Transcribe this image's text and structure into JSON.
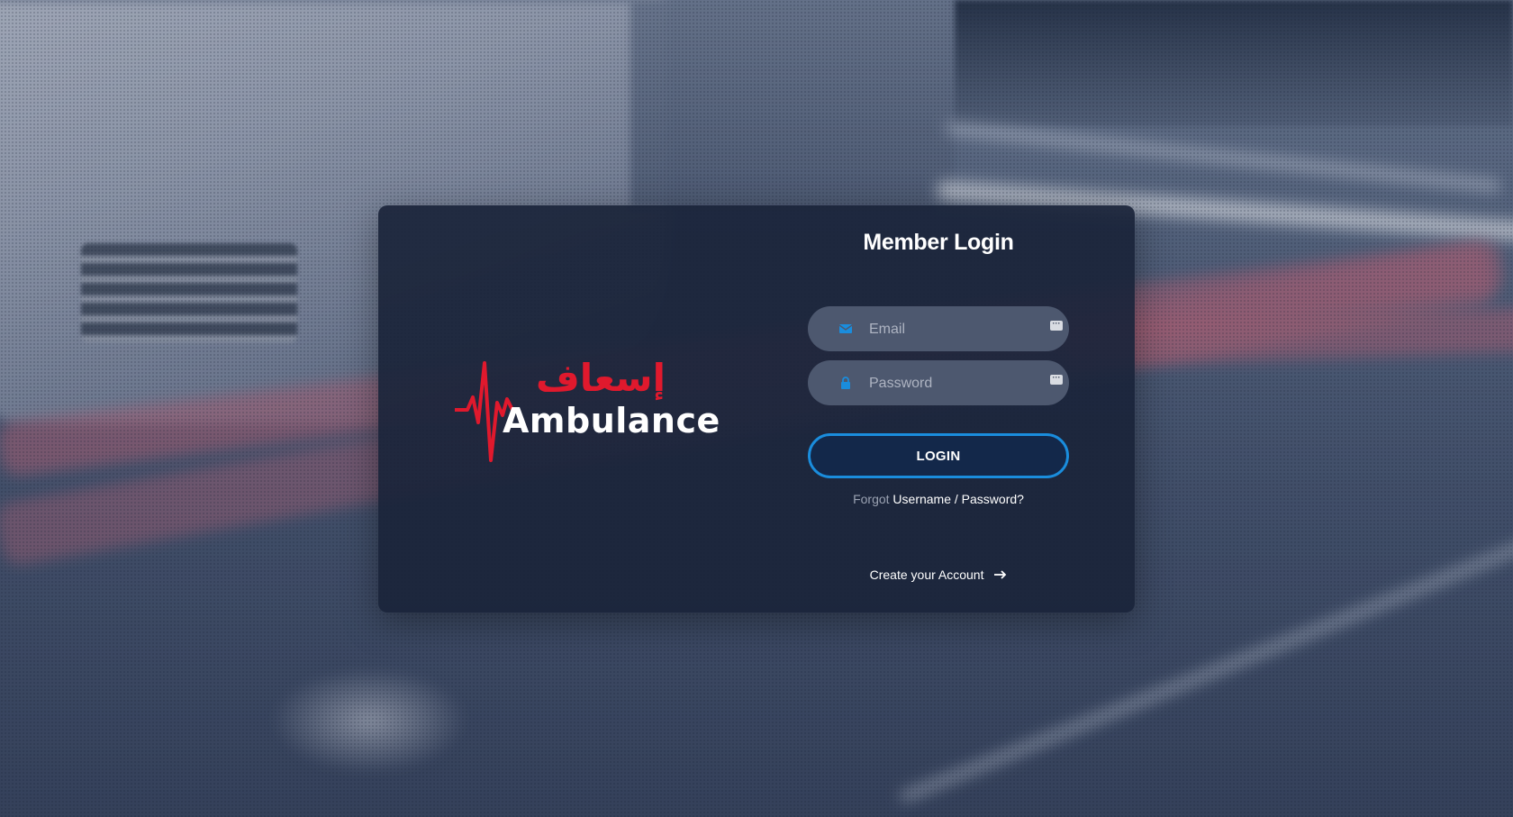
{
  "brand": {
    "name_en": "Ambulance",
    "name_ar": "إسعاف",
    "logo_color": "#e0192d"
  },
  "login": {
    "title": "Member Login",
    "email_placeholder": "Email",
    "password_placeholder": "Password",
    "email_icon": "envelope-icon",
    "password_icon": "lock-icon",
    "field_badge_icon": "more-dots-icon",
    "submit_label": "LOGIN",
    "forgot_prefix": "Forgot",
    "forgot_link": "Username / Password?",
    "create_account_label": "Create your Account",
    "create_account_icon": "arrow-right-icon"
  },
  "colors": {
    "card": "#1a243a",
    "field": "#4d586f",
    "button_border": "#1a8ddd",
    "icon_accent": "#1a8ddd"
  }
}
